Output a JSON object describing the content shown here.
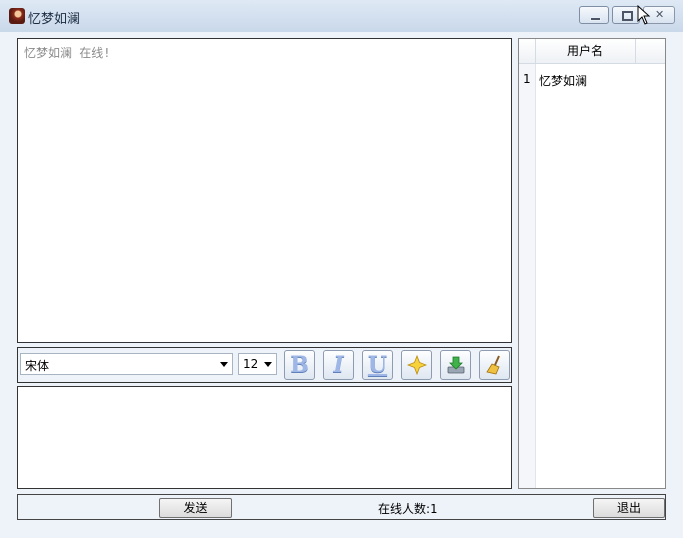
{
  "window": {
    "title": "忆梦如澜",
    "controls": {
      "minimize": "minimize-icon",
      "maximize": "maximize-icon",
      "close": "close-icon"
    }
  },
  "chat": {
    "messages": [
      {
        "text": "忆梦如澜 在线!"
      }
    ]
  },
  "toolbar": {
    "font_family": "宋体",
    "font_size": "12",
    "buttons": [
      {
        "name": "bold",
        "glyph": "B"
      },
      {
        "name": "italic",
        "glyph": "I"
      },
      {
        "name": "underline",
        "glyph": "U"
      },
      {
        "name": "color",
        "icon": "star-icon"
      },
      {
        "name": "save",
        "icon": "download-icon"
      },
      {
        "name": "clear",
        "icon": "broom-icon"
      }
    ]
  },
  "input": {
    "value": ""
  },
  "user_list": {
    "header": "用户名",
    "rows": [
      {
        "index": "1",
        "name": "忆梦如澜"
      }
    ]
  },
  "footer": {
    "send_label": "发送",
    "online_label": "在线人数:",
    "online_count": "1",
    "exit_label": "退出"
  },
  "colors": {
    "titlebar": "#c9d8ea",
    "window": "#eef3f9",
    "chat_text": "#8a8a8a"
  }
}
